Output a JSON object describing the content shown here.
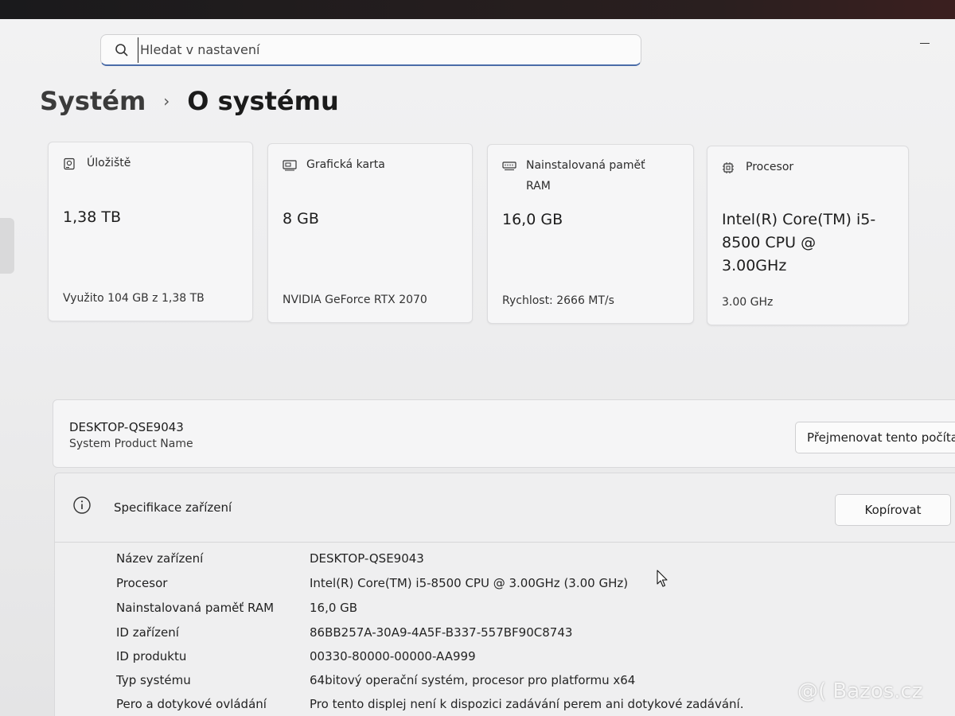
{
  "search": {
    "placeholder": "Hledat v nastavení"
  },
  "breadcrumb": {
    "parent": "Systém",
    "separator": "›",
    "current": "O systému"
  },
  "cards": [
    {
      "title": "Úložiště",
      "icon": "storage-icon",
      "value": "1,38 TB",
      "sub": "Využito 104 GB z 1,38 TB"
    },
    {
      "title": "Grafická karta",
      "icon": "gpu-icon",
      "value": "8 GB",
      "sub": "NVIDIA GeForce RTX 2070"
    },
    {
      "title": "Nainstalovaná paměť RAM",
      "icon": "memory-icon",
      "value": "16,0 GB",
      "sub": "Rychlost: 2666 MT/s"
    },
    {
      "title": "Procesor",
      "icon": "processor-icon",
      "value": "Intel(R) Core(TM) i5-8500 CPU @ 3.00GHz",
      "sub": "3.00 GHz"
    }
  ],
  "device": {
    "name": "DESKTOP-QSE9043",
    "model": "System Product Name",
    "rename_label": "Přejmenovat tento počítač"
  },
  "specs": {
    "title": "Specifikace zařízení",
    "copy_label": "Kopírovat",
    "rows": [
      {
        "label": "Název zařízení",
        "value": "DESKTOP-QSE9043"
      },
      {
        "label": "Procesor",
        "value": "Intel(R) Core(TM) i5-8500 CPU @ 3.00GHz (3.00 GHz)"
      },
      {
        "label": "Nainstalovaná paměť RAM",
        "value": "16,0 GB"
      },
      {
        "label": "ID zařízení",
        "value": "86BB257A-30A9-4A5F-B337-557BF90C8743"
      },
      {
        "label": "ID produktu",
        "value": "00330-80000-00000-AA999"
      },
      {
        "label": "Typ systému",
        "value": "64bitový operační systém, procesor pro platformu x64"
      },
      {
        "label": "Pero a dotykové ovládání",
        "value": "Pro tento displej není k dispozici zadávání perem ani dotykové zadávání."
      }
    ]
  },
  "watermark": "@( Bazos.cz",
  "colors": {
    "accent": "#4a6ca8",
    "background": "#efeff0",
    "card": "#f6f6f7"
  }
}
